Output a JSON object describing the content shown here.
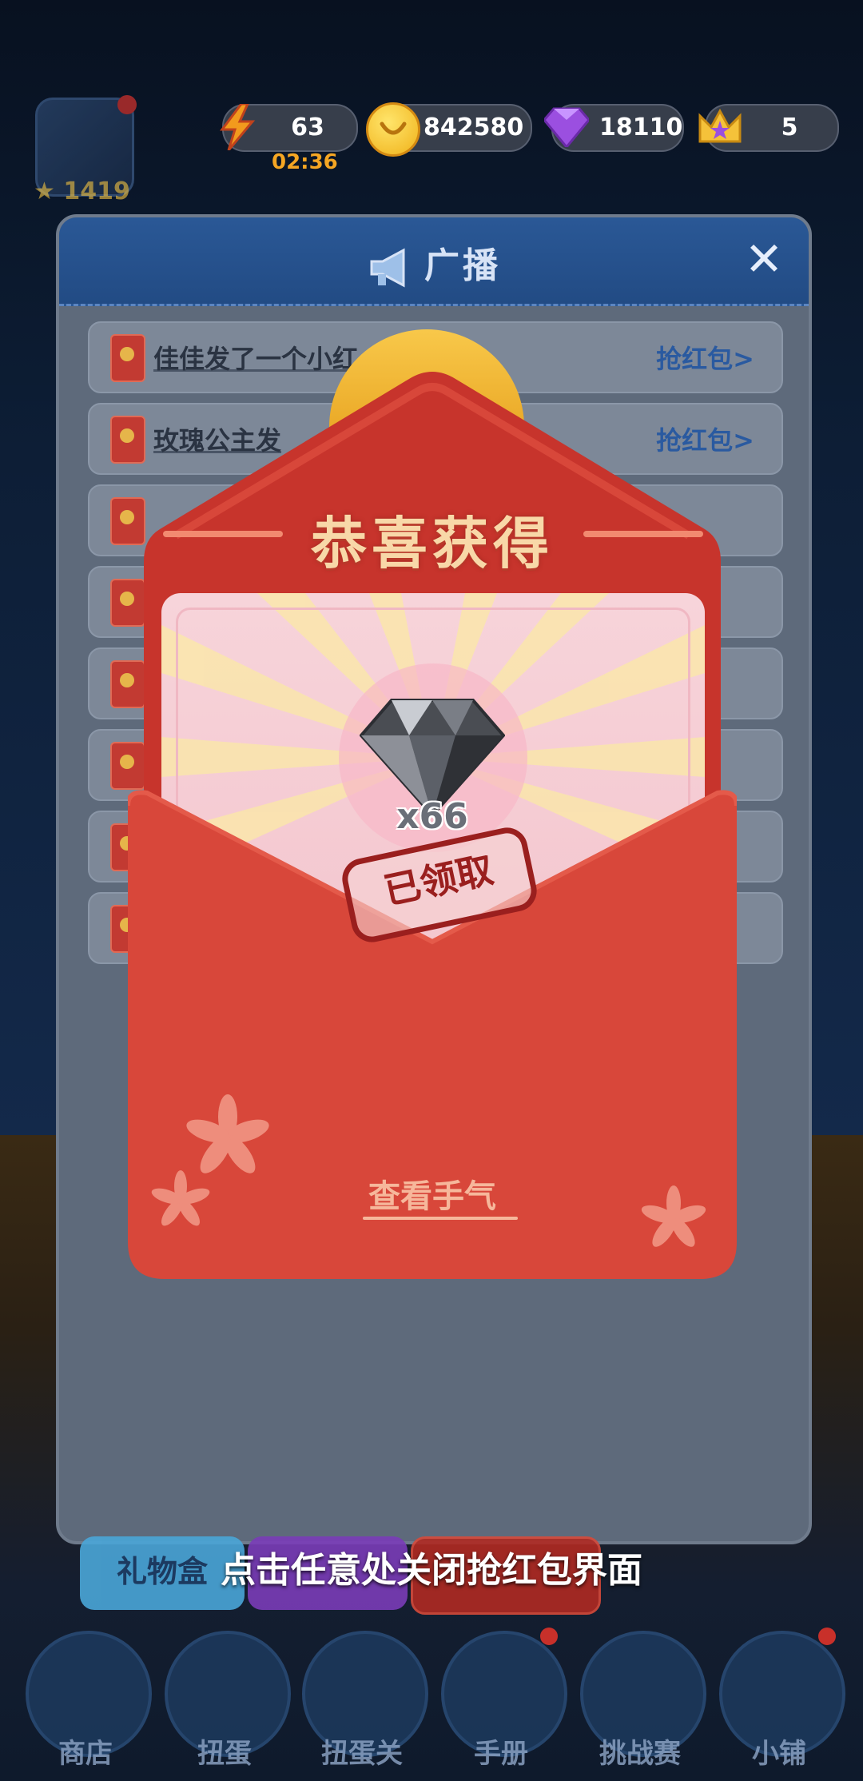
{
  "hud": {
    "energy": "63",
    "energy_timer": "02:36",
    "coins": "842580",
    "gems": "18110",
    "crowns": "5",
    "player_level": "1419"
  },
  "broadcast": {
    "title": "广播",
    "items": [
      {
        "text": "佳佳发了一个小红",
        "link": "抢红包>"
      },
      {
        "text": "玫瑰公主发",
        "link": "抢红包>"
      }
    ]
  },
  "reward": {
    "title": "恭喜获得",
    "item_icon": "black-diamond-icon",
    "quantity": "x66",
    "stamp": "已领取",
    "luck_link": "查看手气"
  },
  "bottom": {
    "hint": "点击任意处关闭抢红包界面",
    "gift_box": "礼物盒",
    "nav": [
      "商店",
      "扭蛋",
      "扭蛋关",
      "手册",
      "挑战赛",
      "小铺"
    ]
  },
  "colors": {
    "envelope_red": "#d8473a",
    "header_blue": "#2a5896",
    "gold": "#f5a623"
  }
}
